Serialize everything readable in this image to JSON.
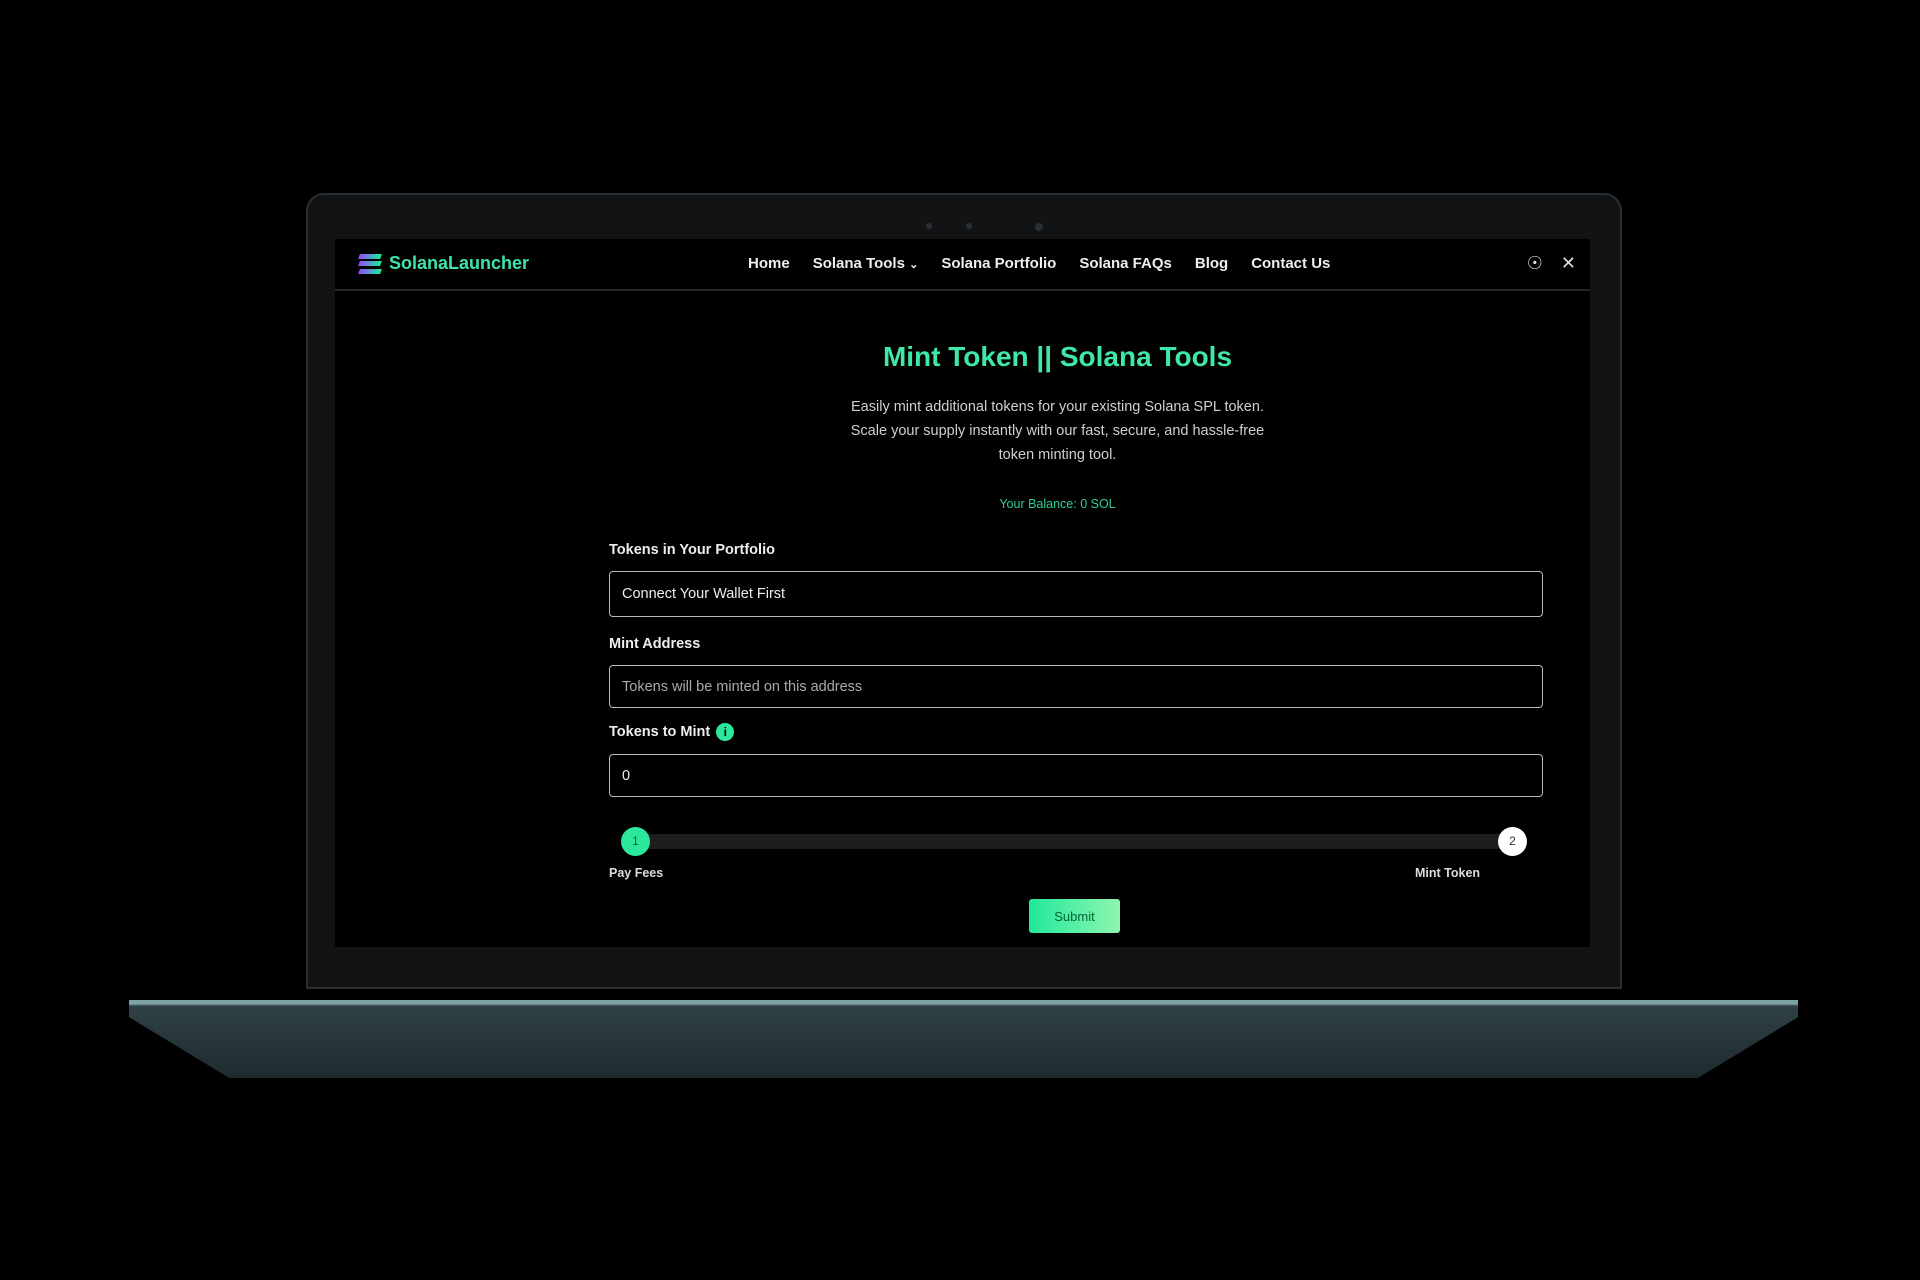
{
  "brand": {
    "name": "SolanaLauncher",
    "accent": "#3fe8a6"
  },
  "nav": {
    "items": [
      {
        "label": "Home"
      },
      {
        "label": "Solana Tools"
      },
      {
        "label": "Solana Portfolio"
      },
      {
        "label": "Solana FAQs"
      },
      {
        "label": "Blog"
      },
      {
        "label": "Contact Us"
      }
    ],
    "social": [
      "discord-icon",
      "x-icon"
    ]
  },
  "page": {
    "title": "Mint Token || Solana Tools",
    "description": [
      "Easily mint additional tokens for your existing Solana SPL token.",
      "Scale your supply instantly with our fast, secure, and hassle-free",
      "token minting tool."
    ],
    "balance": "Your Balance: 0 SOL"
  },
  "form": {
    "portfolio": {
      "label": "Tokens in Your Portfolio",
      "value": "Connect Your Wallet First"
    },
    "mint_address": {
      "label": "Mint Address",
      "placeholder": "Tokens will be minted on this address"
    },
    "tokens_to_mint": {
      "label": "Tokens to Mint",
      "value": "0"
    },
    "steps": [
      {
        "number": "1",
        "label": "Pay Fees",
        "active": true
      },
      {
        "number": "2",
        "label": "Mint Token",
        "active": false
      }
    ],
    "submit": "Submit"
  }
}
